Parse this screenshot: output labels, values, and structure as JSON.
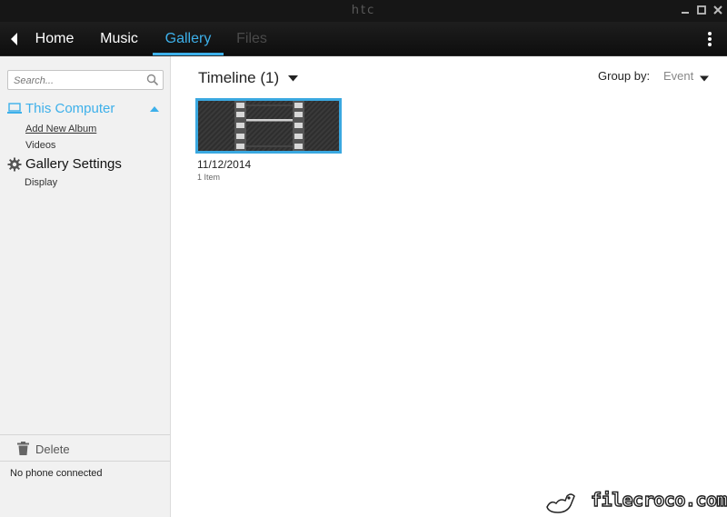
{
  "window": {
    "brand": "htc",
    "controls": [
      "minimize-icon",
      "maximize-icon",
      "close-icon"
    ]
  },
  "nav": {
    "tabs": [
      {
        "label": "Home",
        "state": "normal"
      },
      {
        "label": "Music",
        "state": "normal"
      },
      {
        "label": "Gallery",
        "state": "active"
      },
      {
        "label": "Files",
        "state": "disabled"
      }
    ]
  },
  "sidebar": {
    "search": {
      "placeholder": "Search...",
      "value": ""
    },
    "computer": {
      "label": "This Computer",
      "items": [
        {
          "label": "Add New Album"
        },
        {
          "label": "Videos"
        }
      ]
    },
    "settings": {
      "label": "Gallery Settings",
      "items": [
        {
          "label": "Display"
        }
      ]
    },
    "delete_label": "Delete",
    "status": "No phone connected"
  },
  "main": {
    "timeline_title": "Timeline (1)",
    "group_by_label": "Group by:",
    "group_by_value": "Event",
    "albums": [
      {
        "date": "11/12/2014",
        "count": "1 Item"
      }
    ]
  },
  "watermark": "filecroco.com",
  "colors": {
    "accent": "#3db0ea",
    "titlebar": "#161616",
    "navbar": "#141414",
    "sidebar": "#f1f1f1"
  }
}
